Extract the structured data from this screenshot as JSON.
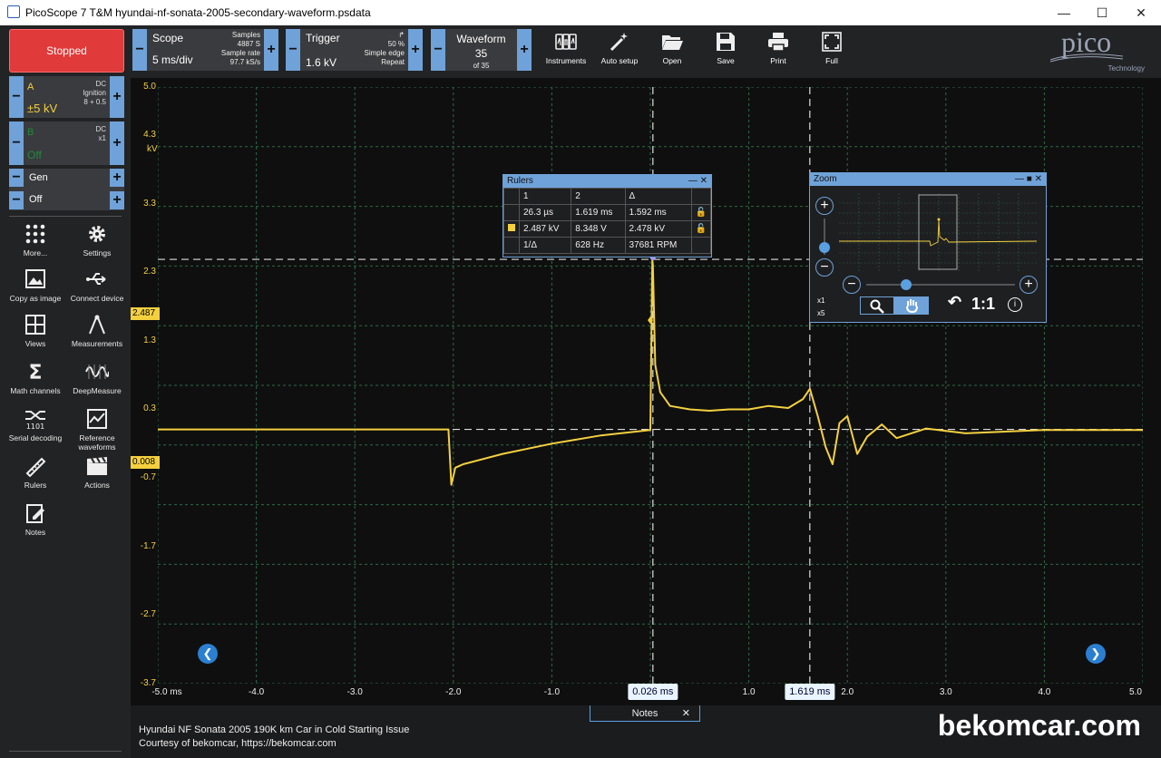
{
  "window": {
    "title": "PicoScope 7 T&M hyundai-nf-sonata-2005-secondary-waveform.psdata"
  },
  "status": {
    "label": "Stopped"
  },
  "channel_a": {
    "name": "A",
    "coupling": "DC",
    "probe": "Ignition",
    "offset": "8 + 0.5",
    "range": "±5 kV"
  },
  "channel_b": {
    "name": "B",
    "coupling": "DC",
    "probe": "x1",
    "range": "Off"
  },
  "gen": {
    "name": "Gen",
    "state": "Off"
  },
  "sidebar_tools": [
    "More...",
    "Settings",
    "Copy as image",
    "Connect device",
    "Views",
    "Measurements",
    "Math channels",
    "DeepMeasure",
    "Serial decoding",
    "Reference waveforms",
    "Rulers",
    "Actions",
    "Notes"
  ],
  "scope": {
    "label": "Scope",
    "timebase": "5 ms/div",
    "samples_label": "Samples",
    "samples": "4887 S",
    "rate_label": "Sample rate",
    "rate": "97.7 kS/s"
  },
  "trigger": {
    "label": "Trigger",
    "level": "1.6 kV",
    "percent": "50 %",
    "type": "Simple edge",
    "mode": "Repeat"
  },
  "waveform": {
    "label": "Waveform",
    "current": "35",
    "of": "of 35"
  },
  "toolbar_buttons": [
    "Instruments",
    "Auto setup",
    "Open",
    "Save",
    "Print",
    "Full"
  ],
  "logo": {
    "text": "pico",
    "sub": "Technology"
  },
  "axes": {
    "y_unit": "kV",
    "y_ticks": [
      "5.0",
      "4.3",
      "3.3",
      "2.3",
      "1.3",
      "0.3",
      "-0.7",
      "-1.7",
      "-2.7",
      "-3.7"
    ],
    "x_ticks": [
      "-5.0 ms",
      "-4.0",
      "-3.0",
      "-2.0",
      "-1.0",
      "0.0",
      "1.0",
      "2.0",
      "3.0",
      "4.0",
      "5.0"
    ]
  },
  "markers": {
    "ruler_upper": "2.487",
    "ruler_lower": "0.008"
  },
  "time_rulers": {
    "r1": "0.026 ms",
    "r2": "1.619 ms"
  },
  "rulers_panel": {
    "title": "Rulers",
    "headers": [
      "1",
      "2",
      "Δ"
    ],
    "row_time": [
      "26.3 µs",
      "1.619 ms",
      "1.592 ms"
    ],
    "row_volt": [
      "2.487 kV",
      "8.348 V",
      "2.478 kV"
    ],
    "freq_label": "1/Δ",
    "freq": "628 Hz",
    "rpm": "37681 RPM"
  },
  "zoom_panel": {
    "title": "Zoom",
    "x1": "x1",
    "x5": "x5",
    "ratio": "1:1"
  },
  "chart_data": {
    "type": "line",
    "series": [
      {
        "name": "A",
        "color": "#f4d03f",
        "x": [
          -5.0,
          -2.05,
          -2.02,
          -1.98,
          -1.9,
          -1.5,
          -1.0,
          -0.5,
          0.0,
          0.02,
          0.026,
          0.05,
          0.1,
          0.15,
          0.2,
          0.4,
          0.6,
          0.8,
          1.0,
          1.2,
          1.4,
          1.55,
          1.62,
          1.7,
          1.78,
          1.85,
          1.92,
          2.0,
          2.1,
          2.2,
          2.35,
          2.5,
          2.8,
          3.2,
          4.0,
          5.0
        ],
        "y": [
          0.008,
          0.008,
          -0.8,
          -0.55,
          -0.5,
          -0.35,
          -0.2,
          -0.08,
          0.0,
          2.487,
          2.4,
          0.95,
          0.55,
          0.45,
          0.35,
          0.3,
          0.28,
          0.3,
          0.3,
          0.35,
          0.32,
          0.45,
          0.6,
          0.2,
          -0.25,
          -0.5,
          0.1,
          0.2,
          -0.35,
          -0.1,
          0.08,
          -0.12,
          0.02,
          -0.05,
          0.0,
          0.0
        ]
      }
    ],
    "xlim": [
      -5.0,
      5.0
    ],
    "ylim": [
      -3.7,
      5.0
    ],
    "xlabel": "",
    "ylabel": "kV",
    "grid": true
  },
  "notes": {
    "tab": "Notes",
    "line1": "Hyundai NF Sonata 2005 190K km Car in Cold Starting Issue",
    "line2": "Courtesy of bekomcar, https://bekomcar.com"
  },
  "watermark": "bekomcar.com"
}
